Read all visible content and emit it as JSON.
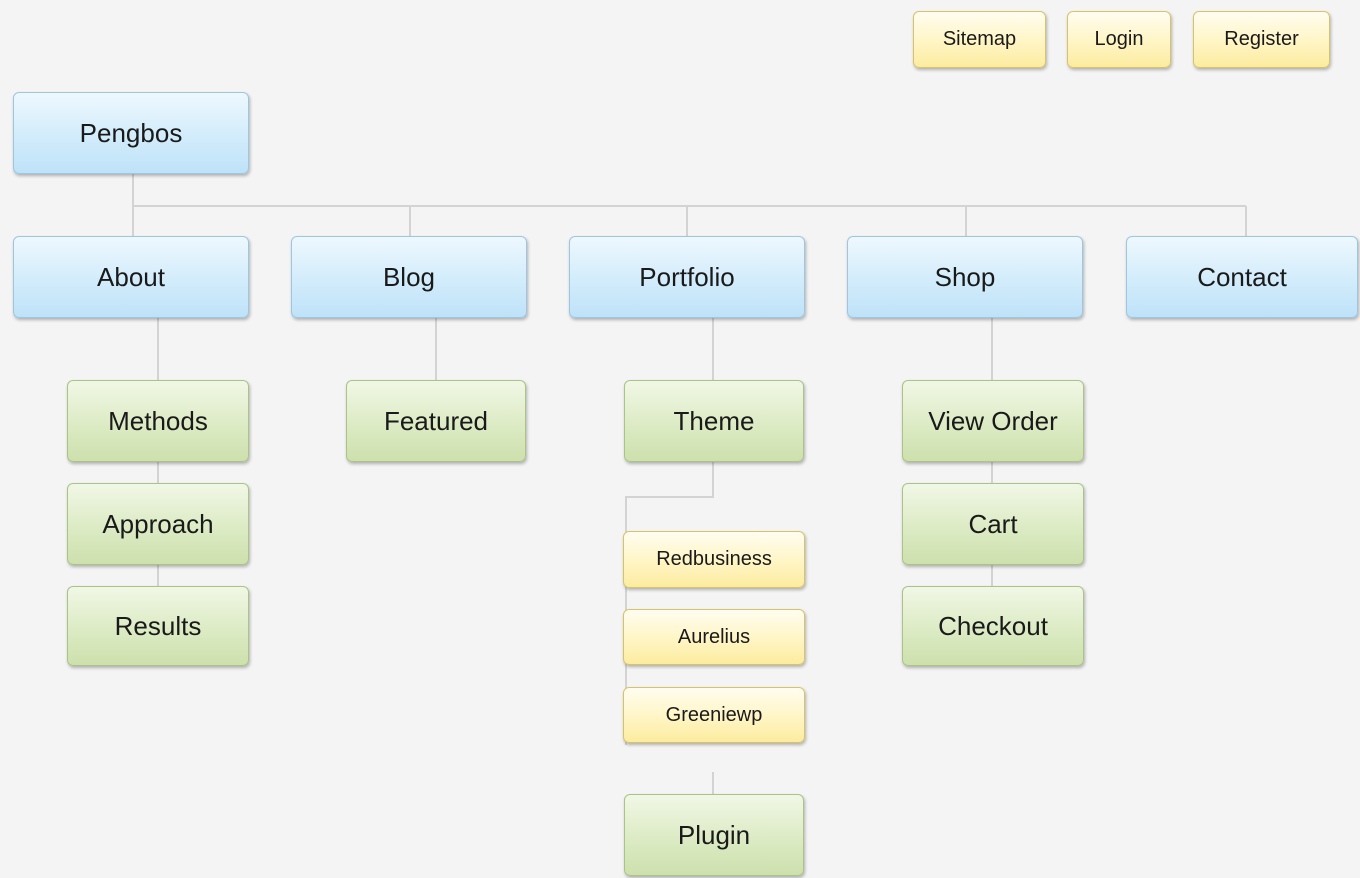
{
  "utility_links": {
    "sitemap": "Sitemap",
    "login": "Login",
    "register": "Register"
  },
  "root": {
    "label": "Pengbos"
  },
  "sections": {
    "about": {
      "label": "About",
      "children": [
        "Methods",
        "Approach",
        "Results"
      ]
    },
    "blog": {
      "label": "Blog",
      "children": [
        "Featured"
      ]
    },
    "portfolio": {
      "label": "Portfolio",
      "theme": {
        "label": "Theme",
        "children": [
          "Redbusiness",
          "Aurelius",
          "Greeniewp"
        ]
      },
      "plugin": {
        "label": "Plugin"
      }
    },
    "shop": {
      "label": "Shop",
      "children": [
        "View Order",
        "Cart",
        "Checkout"
      ]
    },
    "contact": {
      "label": "Contact"
    }
  },
  "colors": {
    "level_1": "#cfe9fa",
    "level_2": "#dcebc4",
    "level_3": "#fff5c4",
    "connector": "#d3d3d3",
    "background": "#f4f4f4"
  }
}
